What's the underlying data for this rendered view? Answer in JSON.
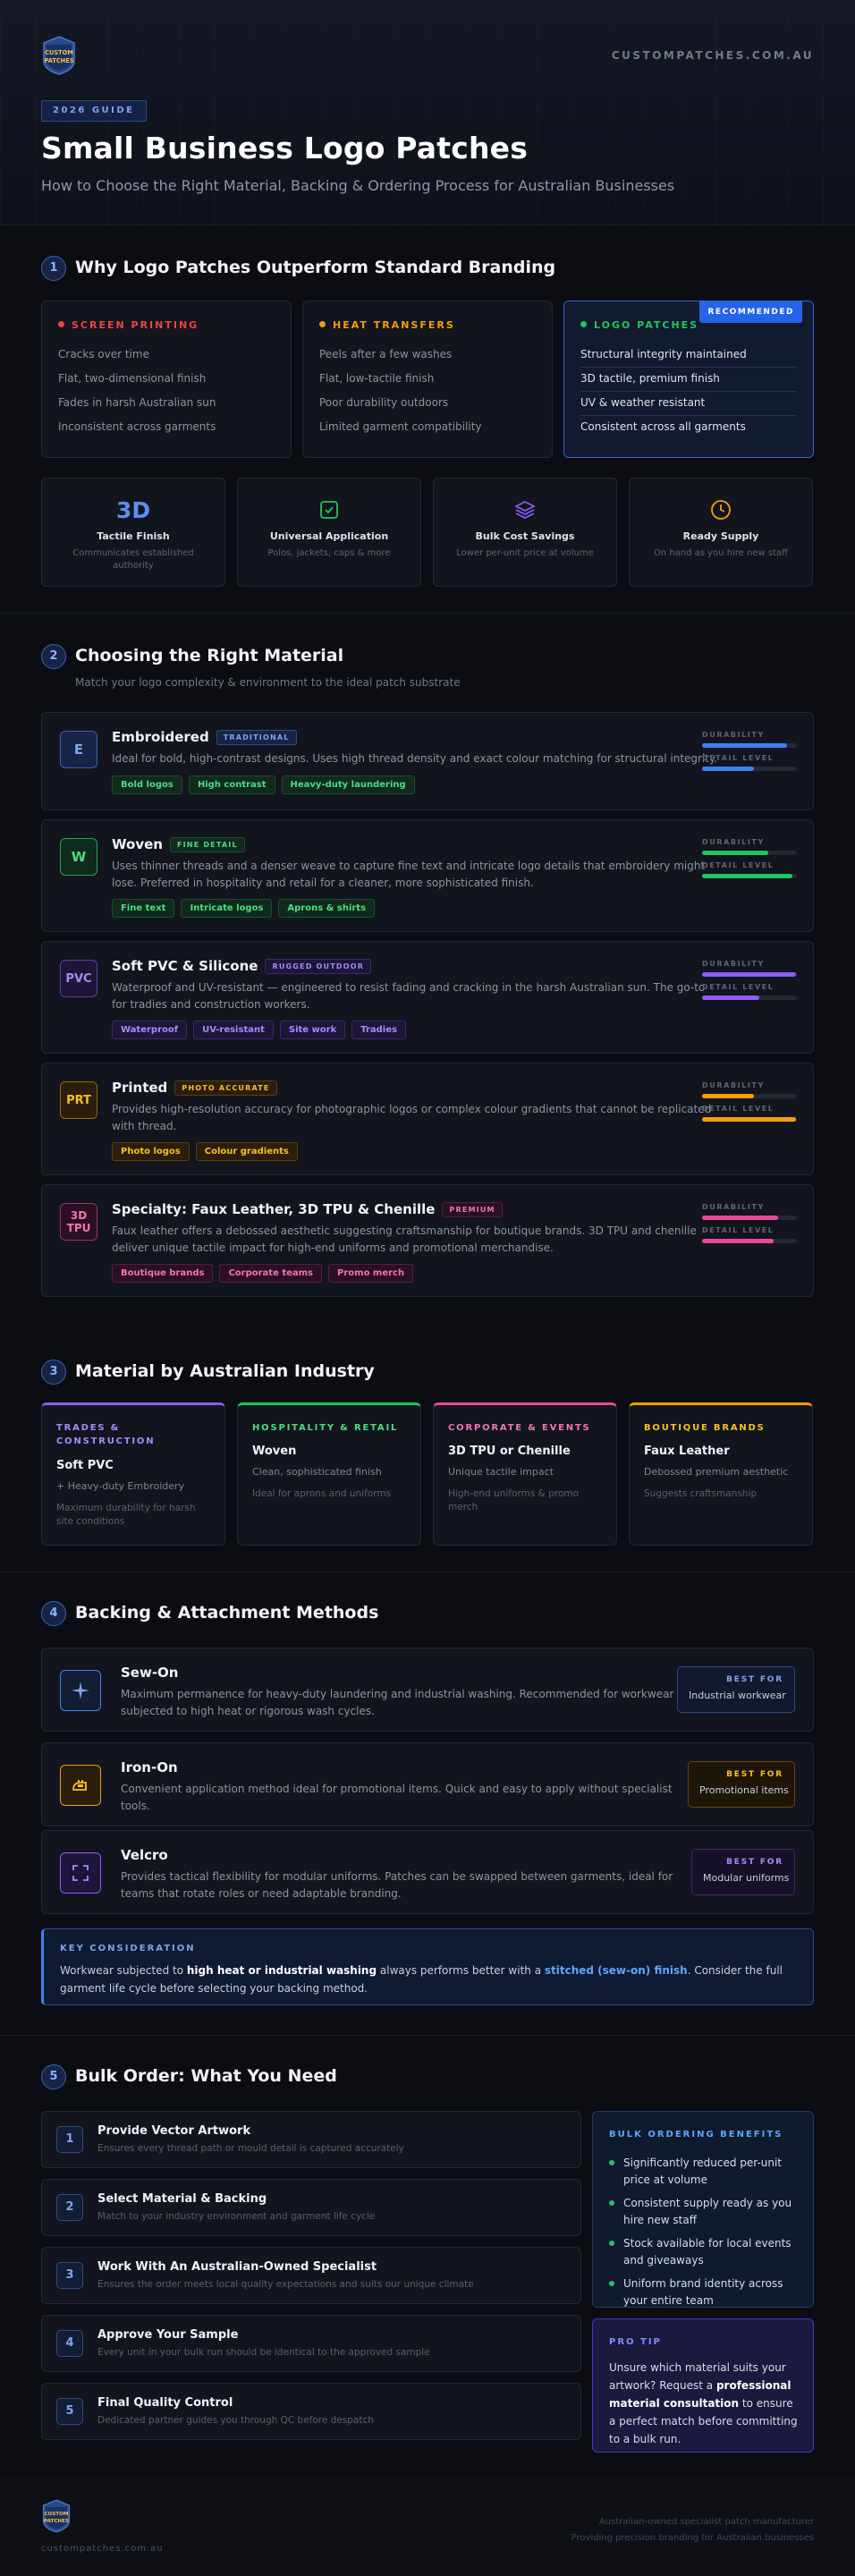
{
  "brand": {
    "logo_text_top": "CUSTOM",
    "logo_text_bottom": "PATCHES",
    "domain": "CUSTOMPATCHES.COM.AU"
  },
  "hero": {
    "tag": "2026 GUIDE",
    "title": "Small Business Logo Patches",
    "subtitle": "How to Choose the Right Material, Backing & Ordering Process for Australian Businesses"
  },
  "s1": {
    "num": "1",
    "title": "Why Logo Patches Outperform Standard Branding",
    "compare": [
      {
        "title": "SCREEN PRINTING",
        "color": "#ef4444",
        "items": [
          "Cracks over time",
          "Flat, two-dimensional finish",
          "Fades in harsh Australian sun",
          "Inconsistent across garments"
        ]
      },
      {
        "title": "HEAT TRANSFERS",
        "color": "#f59e0b",
        "items": [
          "Peels after a few washes",
          "Flat, low-tactile finish",
          "Poor durability outdoors",
          "Limited garment compatibility"
        ]
      },
      {
        "title": "LOGO PATCHES",
        "color": "#22c55e",
        "badge": "RECOMMENDED",
        "items": [
          "Structural integrity maintained",
          "3D tactile, premium finish",
          "UV & weather resistant",
          "Consistent across all garments"
        ]
      }
    ],
    "features": [
      {
        "icon": "3D",
        "icon_name": "3d-text-icon",
        "title": "Tactile Finish",
        "desc": "Communicates established authority"
      },
      {
        "icon_name": "checkbox-icon",
        "title": "Universal Application",
        "desc": "Polos, jackets, caps & more"
      },
      {
        "icon_name": "layers-icon",
        "title": "Bulk Cost Savings",
        "desc": "Lower per-unit price at volume"
      },
      {
        "icon_name": "clock-icon",
        "title": "Ready Supply",
        "desc": "On hand as you hire new staff"
      }
    ]
  },
  "s2": {
    "num": "2",
    "title": "Choosing the Right Material",
    "subtitle": "Match your logo complexity & environment to the ideal patch substrate",
    "durability_label": "DURABILITY",
    "detail_label": "DETAIL LEVEL",
    "materials": [
      {
        "badge": "E",
        "name": "Embroidered",
        "pill": "TRADITIONAL",
        "color": "#3b82f6",
        "desc": "Ideal for bold, high-contrast designs. Uses high thread density and exact colour matching for structural integrity.",
        "chips": [
          "Bold logos",
          "High contrast",
          "Heavy-duty laundering"
        ],
        "durability": 0.9,
        "detail": 0.55
      },
      {
        "badge": "W",
        "name": "Woven",
        "pill": "FINE DETAIL",
        "color": "#22c55e",
        "desc": "Uses thinner threads and a denser weave to capture fine text and intricate logo details that embroidery might lose. Preferred in hospitality and retail for a cleaner, more sophisticated finish.",
        "chips": [
          "Fine text",
          "Intricate logos",
          "Aprons & shirts"
        ],
        "durability": 0.7,
        "detail": 0.95
      },
      {
        "badge": "PVC",
        "name": "Soft PVC & Silicone",
        "pill": "RUGGED OUTDOOR",
        "color": "#8b5cf6",
        "desc": "Waterproof and UV-resistant — engineered to resist fading and cracking in the harsh Australian sun. The go-to for tradies and construction workers.",
        "chips": [
          "Waterproof",
          "UV-resistant",
          "Site work",
          "Tradies"
        ],
        "durability": 0.99,
        "detail": 0.6
      },
      {
        "badge": "PRT",
        "name": "Printed",
        "pill": "PHOTO ACCURATE",
        "color": "#f59e0b",
        "desc": "Provides high-resolution accuracy for photographic logos or complex colour gradients that cannot be replicated with thread.",
        "chips": [
          "Photo logos",
          "Colour gradients"
        ],
        "durability": 0.55,
        "detail": 0.99
      },
      {
        "badge": "3D TPU",
        "name": "Specialty: Faux Leather, 3D TPU & Chenille",
        "pill": "PREMIUM",
        "color": "#ec4899",
        "desc": "Faux leather offers a debossed aesthetic suggesting craftsmanship for boutique brands. 3D TPU and chenille deliver unique tactile impact for high-end uniforms and promotional merchandise.",
        "chips": [
          "Boutique brands",
          "Corporate teams",
          "Promo merch"
        ],
        "durability": 0.8,
        "detail": 0.75
      }
    ]
  },
  "s3": {
    "num": "3",
    "title": "Material by Australian Industry",
    "industries": [
      {
        "title": "TRADES & CONSTRUCTION",
        "color": "#8b5cf6",
        "material": "Soft PVC",
        "alt": "+ Heavy-duty Embroidery",
        "note": "Maximum durability for harsh site conditions"
      },
      {
        "title": "HOSPITALITY & RETAIL",
        "color": "#22c55e",
        "material": "Woven",
        "alt": "Clean, sophisticated finish",
        "note": "Ideal for aprons and uniforms"
      },
      {
        "title": "CORPORATE & EVENTS",
        "color": "#ec4899",
        "material": "3D TPU or Chenille",
        "alt": "Unique tactile impact",
        "note": "High-end uniforms & promo merch"
      },
      {
        "title": "BOUTIQUE BRANDS",
        "color": "#f59e0b",
        "material": "Faux Leather",
        "alt": "Debossed premium aesthetic",
        "note": "Suggests craftsmanship"
      }
    ]
  },
  "s4": {
    "num": "4",
    "title": "Backing & Attachment Methods",
    "best_for_label": "BEST FOR",
    "methods": [
      {
        "name": "Sew-On",
        "icon_name": "sparkle-icon",
        "color": "#3b82f6",
        "desc": "Maximum permanence for heavy-duty laundering and industrial washing. Recommended for workwear subjected to high heat or rigorous wash cycles.",
        "best": "Industrial workwear"
      },
      {
        "name": "Iron-On",
        "icon_name": "iron-icon",
        "color": "#f59e0b",
        "desc": "Convenient application method ideal for promotional items. Quick and easy to apply without specialist tools.",
        "best": "Promotional items"
      },
      {
        "name": "Velcro",
        "icon_name": "velcro-icon",
        "color": "#8b5cf6",
        "desc": "Provides tactical flexibility for modular uniforms. Patches can be swapped between garments, ideal for teams that rotate roles or need adaptable branding.",
        "best": "Modular uniforms"
      }
    ],
    "key": {
      "title": "KEY CONSIDERATION",
      "p1": "Workwear subjected to ",
      "b1": "high heat or industrial washing",
      "p2": " always performs better with a ",
      "b2": "stitched (sew-on) finish",
      "p3": ". Consider the full garment life cycle before selecting your backing method."
    }
  },
  "s5": {
    "num": "5",
    "title": "Bulk Order: What You Need",
    "steps": [
      {
        "n": "1",
        "title": "Provide Vector Artwork",
        "desc": "Ensures every thread path or mould detail is captured accurately"
      },
      {
        "n": "2",
        "title": "Select Material & Backing",
        "desc": "Match to your industry environment and garment life cycle"
      },
      {
        "n": "3",
        "title": "Work With An Australian-Owned Specialist",
        "desc": "Ensures the order meets local quality expectations and suits our unique climate"
      },
      {
        "n": "4",
        "title": "Approve Your Sample",
        "desc": "Every unit in your bulk run should be identical to the approved sample"
      },
      {
        "n": "5",
        "title": "Final Quality Control",
        "desc": "Dedicated partner guides you through QC before despatch"
      }
    ],
    "benefits": {
      "title": "BULK ORDERING BENEFITS",
      "items": [
        "Significantly reduced per-unit price at volume",
        "Consistent supply ready as you hire new staff",
        "Stock available for local events and giveaways",
        "Uniform brand identity across your entire team"
      ]
    },
    "pro": {
      "title": "PRO TIP",
      "p1": "Unsure which material suits your artwork? Request a ",
      "b1": "professional material consultation",
      "p2": " to ensure a perfect match before committing to a bulk run."
    }
  },
  "footer": {
    "domain": "custompatches.com.au",
    "line1": "Australian-owned specialist patch manufacturer",
    "line2": "Providing precision branding for Australian businesses"
  }
}
